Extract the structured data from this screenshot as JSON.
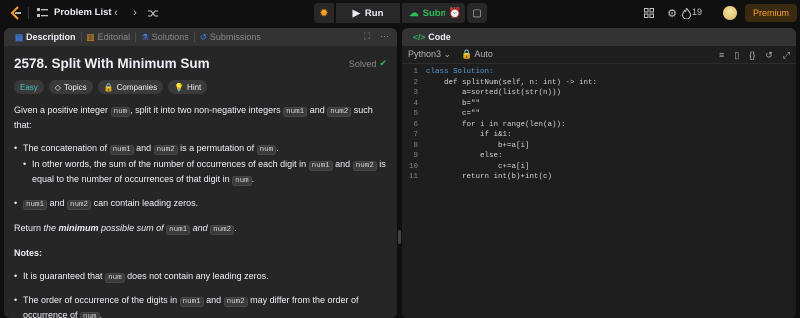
{
  "nav": {
    "title": "Problem List",
    "run": "Run",
    "submit": "Submit",
    "streak": "19",
    "premium": "Premium"
  },
  "left": {
    "tabs": [
      "Description",
      "Editorial",
      "Solutions",
      "Submissions"
    ],
    "title": "2578. Split With Minimum Sum",
    "status": "Solved",
    "tags": [
      "Easy",
      "Topics",
      "Companies",
      "Hint"
    ],
    "intro": {
      "a": "Given a positive integer ",
      "c1": "num",
      "b": ", split it into two non-negative integers ",
      "c2": "num1",
      "and": " and ",
      "c3": "num2",
      "d": " such that:"
    },
    "b1": {
      "a": "The concatenation of ",
      "c1": "num1",
      "and": " and ",
      "c2": "num2",
      "b": " is a permutation of ",
      "c3": "num",
      "d": "."
    },
    "b1s": {
      "a": "In other words, the sum of the number of occurrences of each digit in ",
      "c1": "num1",
      "and": " and ",
      "c2": "num2",
      "b": " is equal to the number of occurrences of that digit in ",
      "c3": "num",
      "d": "."
    },
    "b2": {
      "c1": "num1",
      "and": " and ",
      "c2": "num2",
      "b": " can contain leading zeros."
    },
    "ret": {
      "a": "Return ",
      "b": "the ",
      "bold": "minimum",
      "c": " possible sum of ",
      "c1": "num1",
      "and": " and ",
      "c2": "num2",
      "d": "."
    },
    "notes": "Notes:",
    "n1": {
      "a": "It is guaranteed that ",
      "c1": "num",
      "b": " does not contain any leading zeros."
    },
    "n2": {
      "a": "The order of occurrence of the digits in ",
      "c1": "num1",
      "and": " and ",
      "c2": "num2",
      "b": " may differ from the order of occurrence of ",
      "c3": "num",
      "d": "."
    }
  },
  "right": {
    "tab": "Code",
    "language": "Python3",
    "mode": "Auto",
    "lines": [
      "class Solution:",
      "    def splitNum(self, n: int) -> int:",
      "        a=sorted(list(str(n)))",
      "        b=\"\"",
      "        c=\"\"",
      "        for i in range(len(a)):",
      "            if i&1:",
      "                b+=a[i]",
      "            else:",
      "                c+=a[i]",
      "        return int(b)+int(c)"
    ]
  },
  "colors": {
    "accent": "#ffa116",
    "green": "#2cbb5d",
    "easy": "#46c6c2"
  }
}
